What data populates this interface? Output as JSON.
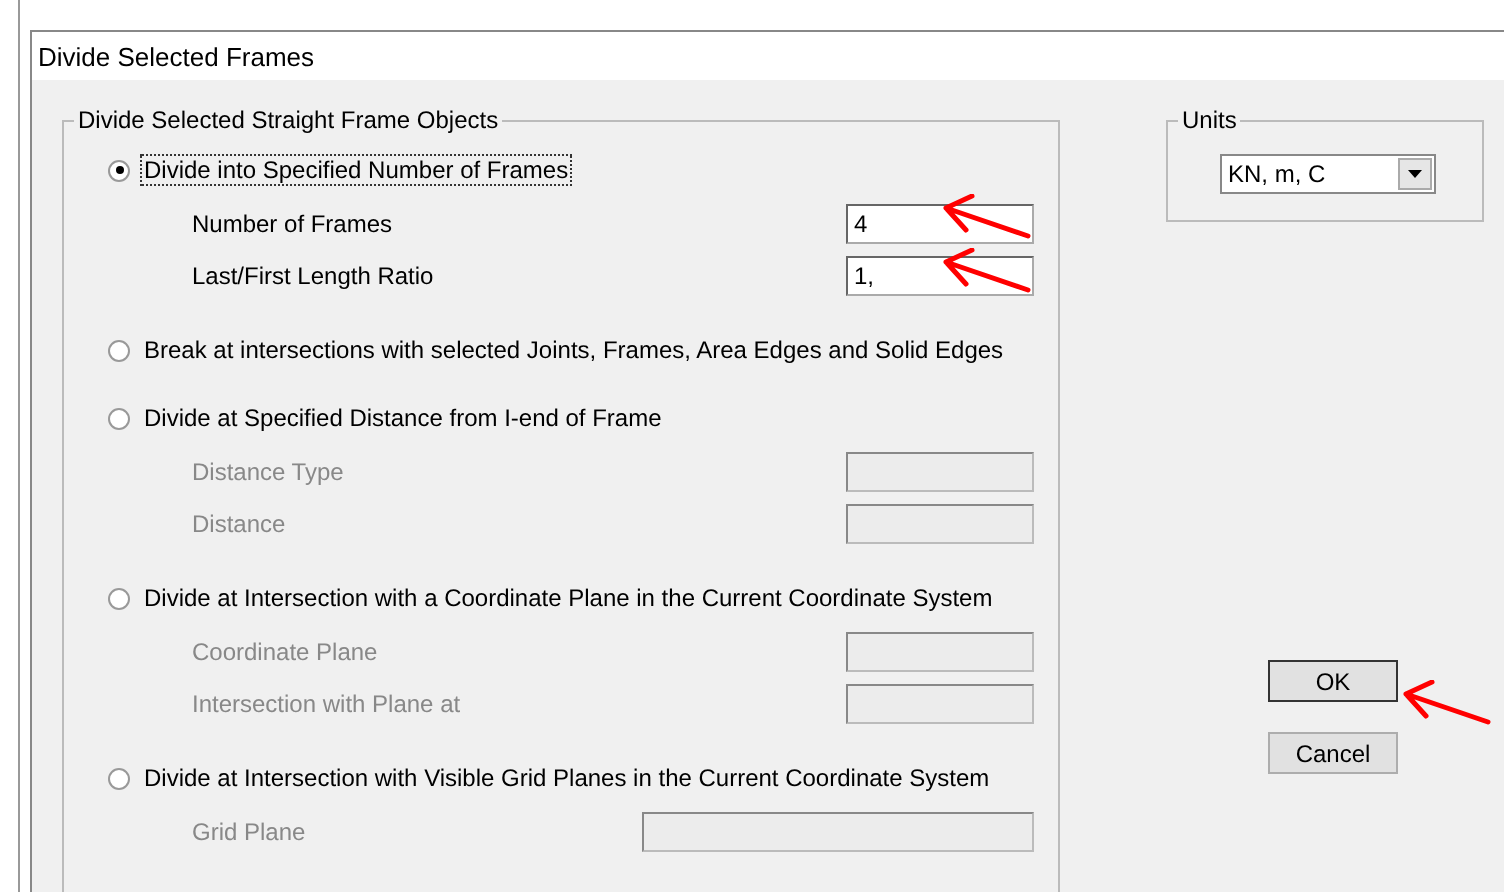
{
  "window": {
    "title": "Divide Selected Frames"
  },
  "group": {
    "title": "Divide Selected Straight Frame Objects"
  },
  "options": [
    {
      "label": "Divide into Specified Number of Frames",
      "selected": true,
      "focused": true,
      "fields": [
        {
          "label": "Number of Frames",
          "value": "4",
          "disabled": false,
          "kind": "short"
        },
        {
          "label": "Last/First Length Ratio",
          "value": "1,",
          "disabled": false,
          "kind": "short"
        }
      ]
    },
    {
      "label": "Break at intersections with selected Joints, Frames, Area Edges and Solid Edges",
      "selected": false,
      "focused": false
    },
    {
      "label": "Divide at Specified Distance from I-end of Frame",
      "selected": false,
      "focused": false,
      "fields": [
        {
          "label": "Distance Type",
          "disabled": true,
          "kind": "short"
        },
        {
          "label": "Distance",
          "disabled": true,
          "kind": "short"
        }
      ]
    },
    {
      "label": "Divide at Intersection with a Coordinate Plane in the Current Coordinate System",
      "selected": false,
      "focused": false,
      "fields": [
        {
          "label": "Coordinate Plane",
          "disabled": true,
          "kind": "short"
        },
        {
          "label": "Intersection with Plane at",
          "disabled": true,
          "kind": "short"
        }
      ]
    },
    {
      "label": "Divide at Intersection with Visible Grid Planes in the Current Coordinate System",
      "selected": false,
      "focused": false,
      "fields": [
        {
          "label": "Grid Plane",
          "disabled": true,
          "kind": "wide"
        }
      ]
    }
  ],
  "units": {
    "title": "Units",
    "value": "KN, m, C"
  },
  "buttons": [
    "OK",
    "Cancel"
  ]
}
